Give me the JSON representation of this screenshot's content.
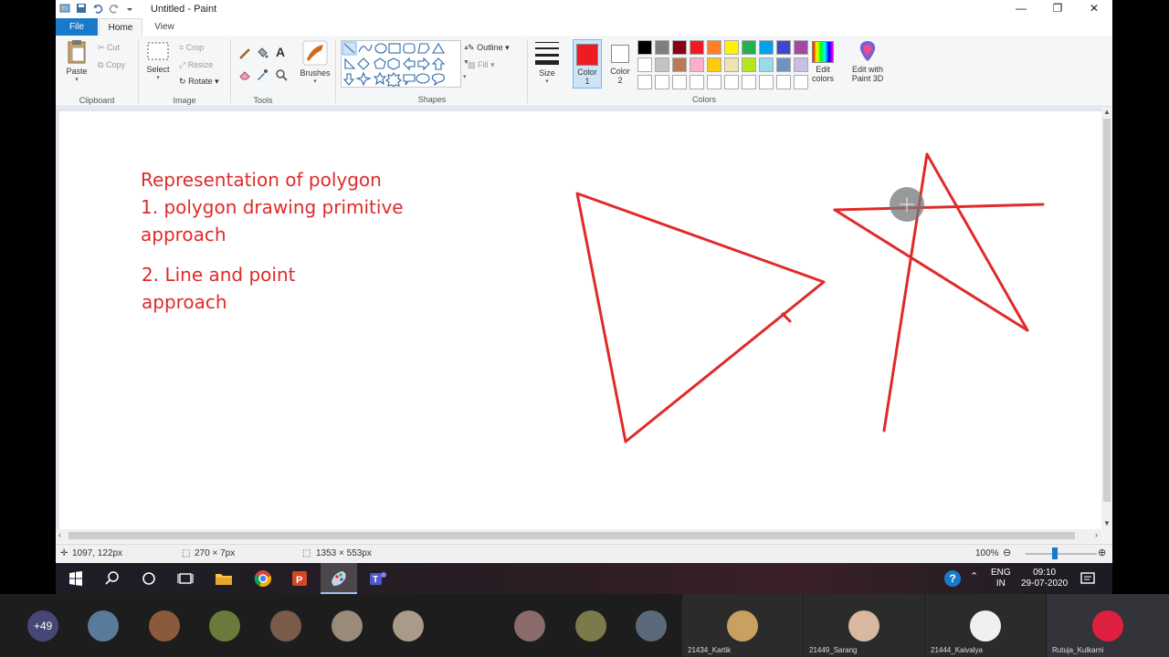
{
  "window": {
    "title": "Untitled - Paint",
    "minimize": "—",
    "restore": "❐",
    "close": "✕"
  },
  "tabs": {
    "file": "File",
    "home": "Home",
    "view": "View"
  },
  "ribbon": {
    "clipboard": {
      "paste": "Paste",
      "cut": "Cut",
      "copy": "Copy",
      "label": "Clipboard"
    },
    "image": {
      "select": "Select",
      "crop": "Crop",
      "resize": "Resize",
      "rotate": "Rotate",
      "label": "Image"
    },
    "tools": {
      "label": "Tools"
    },
    "brushes": "Brushes",
    "shapes": {
      "outline": "Outline",
      "fill": "Fill",
      "label": "Shapes"
    },
    "size": "Size",
    "color1": "Color\n1",
    "color1_a": "Color",
    "color1_b": "1",
    "color2_a": "Color",
    "color2_b": "2",
    "edit_colors_a": "Edit",
    "edit_colors_b": "colors",
    "paint3d_a": "Edit with",
    "paint3d_b": "Paint 3D",
    "colors_label": "Colors",
    "active_color": "#ed1c24",
    "palette": [
      "#000000",
      "#7f7f7f",
      "#880015",
      "#ed1c24",
      "#ff7f27",
      "#fff200",
      "#22b14c",
      "#00a2e8",
      "#3f48cc",
      "#a349a4",
      "#ffffff",
      "#c3c3c3",
      "#b97a57",
      "#ffaec9",
      "#ffc90e",
      "#efe4b0",
      "#b5e61d",
      "#99d9ea",
      "#7092be",
      "#c8bfe7",
      "#ffffff",
      "#ffffff",
      "#ffffff",
      "#ffffff",
      "#ffffff",
      "#ffffff",
      "#ffffff",
      "#ffffff",
      "#ffffff",
      "#ffffff"
    ]
  },
  "canvas": {
    "text_lines": [
      "Representation of polygon",
      "1. polygon drawing primitive",
      "approach"
    ],
    "text_lines_2": [
      "2. Line and point",
      "approach"
    ],
    "stroke_color": "#e02a2a"
  },
  "status": {
    "cursor_pos": "1097, 122px",
    "selection_size": "270 × 7px",
    "image_size": "1353 × 553px",
    "zoom": "100%"
  },
  "taskbar": {
    "lang_a": "ENG",
    "lang_b": "IN",
    "time": "09:10",
    "date": "29-07-2020"
  },
  "meeting": {
    "more_count": "+49",
    "tiles": [
      "21434_Kartik",
      "21449_Sarang",
      "21444_Kaivalya",
      "Rutuja_Kulkarni"
    ]
  }
}
